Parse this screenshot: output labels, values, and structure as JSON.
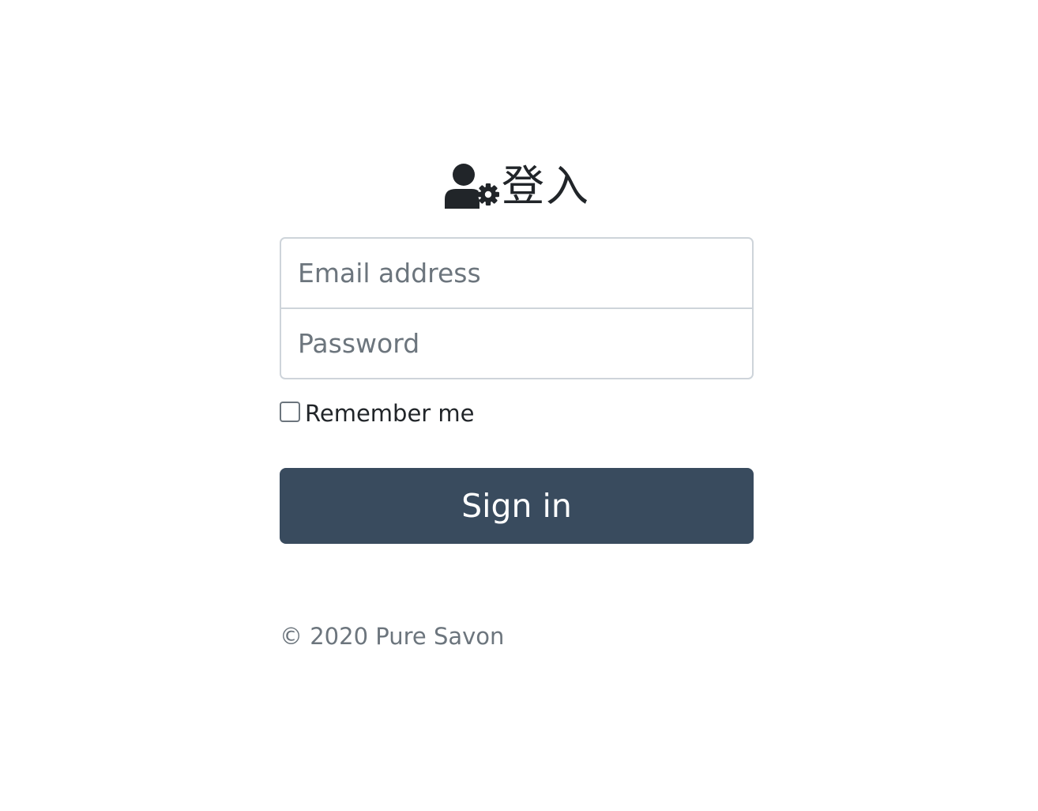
{
  "form": {
    "heading_icon": "user-cog-icon",
    "heading": "登入",
    "email_placeholder": "Email address",
    "password_placeholder": "Password",
    "remember_label": "Remember me",
    "remember_checked": false,
    "submit_label": "Sign in",
    "copyright": "© 2020 Pure Savon"
  },
  "colors": {
    "button_bg": "#394b5e",
    "button_text": "#ffffff",
    "muted_text": "#6c757d",
    "border": "#ced4da"
  }
}
